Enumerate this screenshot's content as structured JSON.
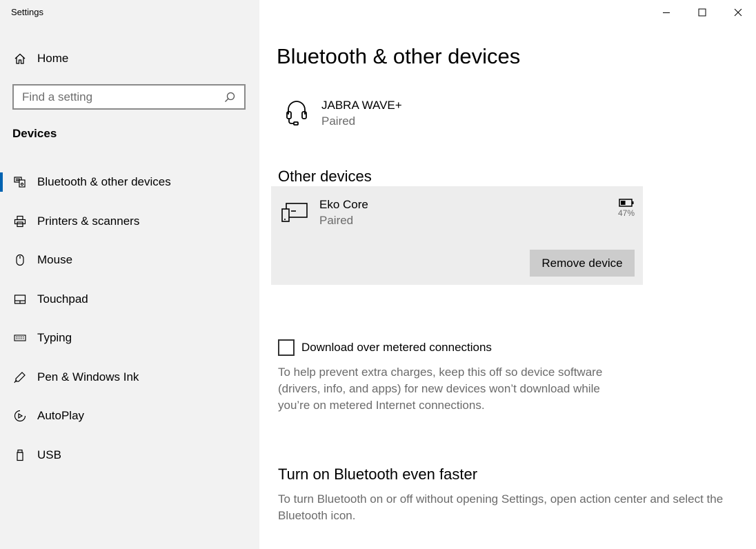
{
  "window": {
    "title": "Settings"
  },
  "sidebar": {
    "home_label": "Home",
    "search_placeholder": "Find a setting",
    "section_title": "Devices",
    "items": [
      {
        "label": "Bluetooth & other devices",
        "icon": "bluetooth-devices-icon",
        "active": true
      },
      {
        "label": "Printers & scanners",
        "icon": "printer-icon"
      },
      {
        "label": "Mouse",
        "icon": "mouse-icon"
      },
      {
        "label": "Touchpad",
        "icon": "touchpad-icon"
      },
      {
        "label": "Typing",
        "icon": "keyboard-icon"
      },
      {
        "label": "Pen & Windows Ink",
        "icon": "pen-icon"
      },
      {
        "label": "AutoPlay",
        "icon": "autoplay-icon"
      },
      {
        "label": "USB",
        "icon": "usb-icon"
      }
    ]
  },
  "main": {
    "title": "Bluetooth & other devices",
    "headset": {
      "name": "JABRA WAVE+",
      "status": "Paired",
      "icon": "headset-icon"
    },
    "other_devices": {
      "title": "Other devices",
      "device": {
        "name": "Eko Core",
        "status": "Paired",
        "icon": "device-icon",
        "battery_label": "47%",
        "battery_level": 0.47
      },
      "remove_label": "Remove device"
    },
    "metered": {
      "label": "Download over metered connections",
      "checked": false,
      "help": "To help prevent extra charges, keep this off so device software (drivers, info, and apps) for new devices won’t download while you’re on metered Internet connections."
    },
    "faster": {
      "title": "Turn on Bluetooth even faster",
      "text": "To turn Bluetooth on or off without opening Settings, open action center and select the Bluetooth icon."
    }
  },
  "colors": {
    "accent": "#0063b1",
    "sidebar_bg": "#f2f2f2",
    "panel_bg": "#ededed",
    "button_bg": "#cccccc"
  }
}
